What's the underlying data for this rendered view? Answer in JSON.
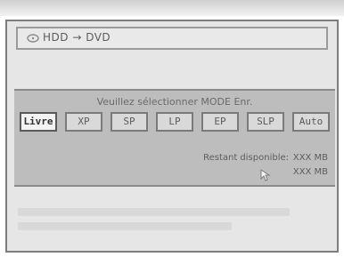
{
  "screen": {
    "menu_strip": "",
    "header": {
      "title": "HDD → DVD"
    },
    "dialog": {
      "prompt": "Veuillez sélectionner MODE Enr.",
      "modes": [
        {
          "label": "Livre",
          "selected": true
        },
        {
          "label": "XP",
          "selected": false
        },
        {
          "label": "SP",
          "selected": false
        },
        {
          "label": "LP",
          "selected": false
        },
        {
          "label": "EP",
          "selected": false
        },
        {
          "label": "SLP",
          "selected": false
        },
        {
          "label": "Auto",
          "selected": false
        }
      ],
      "free_space_label": "Restant disponible:",
      "free_space_value": "XXX MB",
      "sub_value": "XXX MB"
    },
    "icons": {
      "header_icon": "disc-icon",
      "pointer_icon": "cursor-arrow-icon"
    }
  }
}
